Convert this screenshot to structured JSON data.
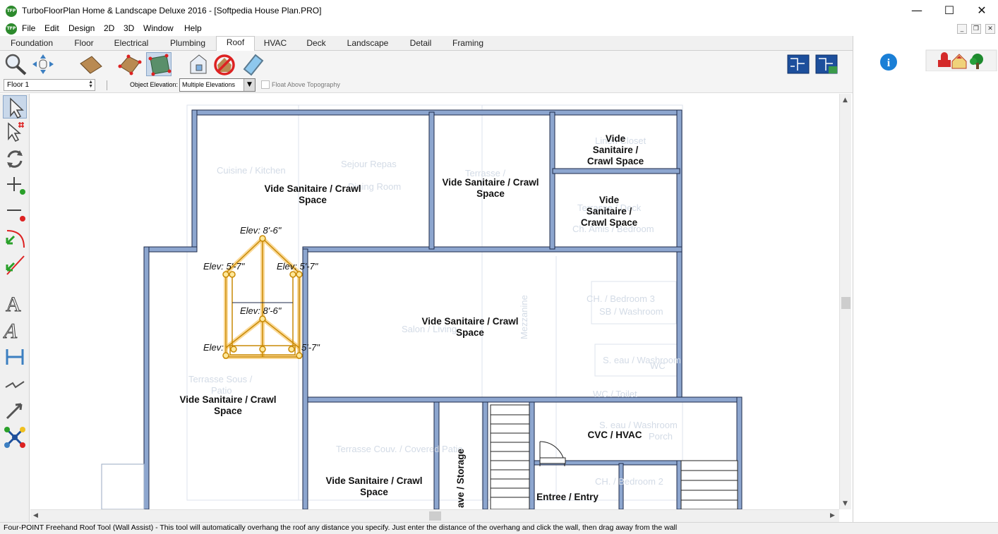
{
  "window": {
    "title": "TurboFloorPlan Home & Landscape Deluxe 2016 - [Softpedia House Plan.PRO]",
    "logo_text": "TFP",
    "minimize_glyph": "—",
    "maximize_glyph": "☐",
    "close_glyph": "✕"
  },
  "menu": {
    "items": [
      "File",
      "Edit",
      "Design",
      "2D",
      "3D",
      "Window",
      "Help"
    ],
    "mdi_min": "_",
    "mdi_restore": "❐",
    "mdi_close": "✕"
  },
  "tabs": {
    "items": [
      "Foundation",
      "Floor",
      "Electrical",
      "Plumbing",
      "Roof",
      "HVAC",
      "Deck",
      "Landscape",
      "Detail",
      "Framing"
    ],
    "active": "Roof"
  },
  "toolbar": {
    "icons": [
      "zoom-icon",
      "pan-icon",
      "roof-icon",
      "roof-plane-icon",
      "four-point-roof-icon",
      "dormer-icon",
      "no-roof-icon",
      "skylight-icon"
    ],
    "view_icons": [
      "plan-view-icon",
      "plan-view-alt-icon"
    ],
    "info_icon": "info-icon",
    "library_icons": [
      "furniture-icon",
      "house-icon",
      "tree-icon"
    ]
  },
  "options": {
    "floor_value": "Floor 1",
    "object_elevation_label": "Object Elevation:",
    "object_elevation_value": "Multiple Elevations",
    "float_label": "Float Above Topography",
    "float_checked": false
  },
  "left_tools": [
    "select-icon",
    "multi-select-icon",
    "rotate-icon",
    "add-point-icon",
    "remove-point-icon",
    "curve-tool-icon",
    "line-tool-icon",
    "text-icon",
    "angled-text-icon",
    "dimension-icon",
    "break-line-icon",
    "arrow-icon",
    "connect-icon"
  ],
  "plan": {
    "rooms": [
      {
        "label": [
          "Vide Sanitaire / Crawl",
          "Space"
        ]
      },
      {
        "label": [
          "Vide Sanitaire / Crawl",
          "Space"
        ]
      },
      {
        "label": [
          "Vide",
          "Sanitaire /",
          "Crawl Space"
        ]
      },
      {
        "label": [
          "Vide",
          "Sanitaire /",
          "Crawl Space"
        ]
      },
      {
        "label": [
          "Vide Sanitaire / Crawl",
          "Space"
        ]
      },
      {
        "label": [
          "Vide Sanitaire / Crawl",
          "Space"
        ]
      },
      {
        "label": [
          "Vide Sanitaire / Crawl",
          "Space"
        ]
      },
      {
        "label": [
          "CVC / HVAC"
        ]
      },
      {
        "label": [
          "Entree / Entry"
        ]
      },
      {
        "label": [
          "ave / Storage"
        ]
      }
    ],
    "ghost_labels": [
      "Cuisine / Kitchen",
      "Sejour Repas",
      "Dining Room",
      "Terrasse /",
      "Linen Closet",
      "Terrasse / Deck",
      "Ch. Amis / Bedroom",
      "CH. / Bedroom 3",
      "SB / Washroom",
      "Salon / Living",
      "Mezzanine",
      "S. eau / Washroom",
      "WC",
      "WC / Toilet",
      "Terrasse Sous /",
      "Patio",
      "Terrasse Couv. / Covered Patio",
      "S. eau / Washroom",
      "Porch",
      "CH. / Bedroom 2"
    ],
    "elevations": [
      "Elev: 8'-6\"",
      "Elev: 5'-7\"",
      "Elev: 5'-7\"",
      "Elev: 8'-6\"",
      "Elev:",
      "5'-7\""
    ]
  },
  "status": {
    "text": "Four-POINT Freehand Roof Tool (Wall Assist) - This tool will automatically overhang the roof any distance you specify. Just enter the distance of the overhang and click the wall, then drag away from the wall"
  },
  "colors": {
    "wall": "#8da6cf",
    "wall_outline": "#1d2a4a",
    "roof_line": "#f0a81a",
    "accent": "#3c7fc1"
  }
}
